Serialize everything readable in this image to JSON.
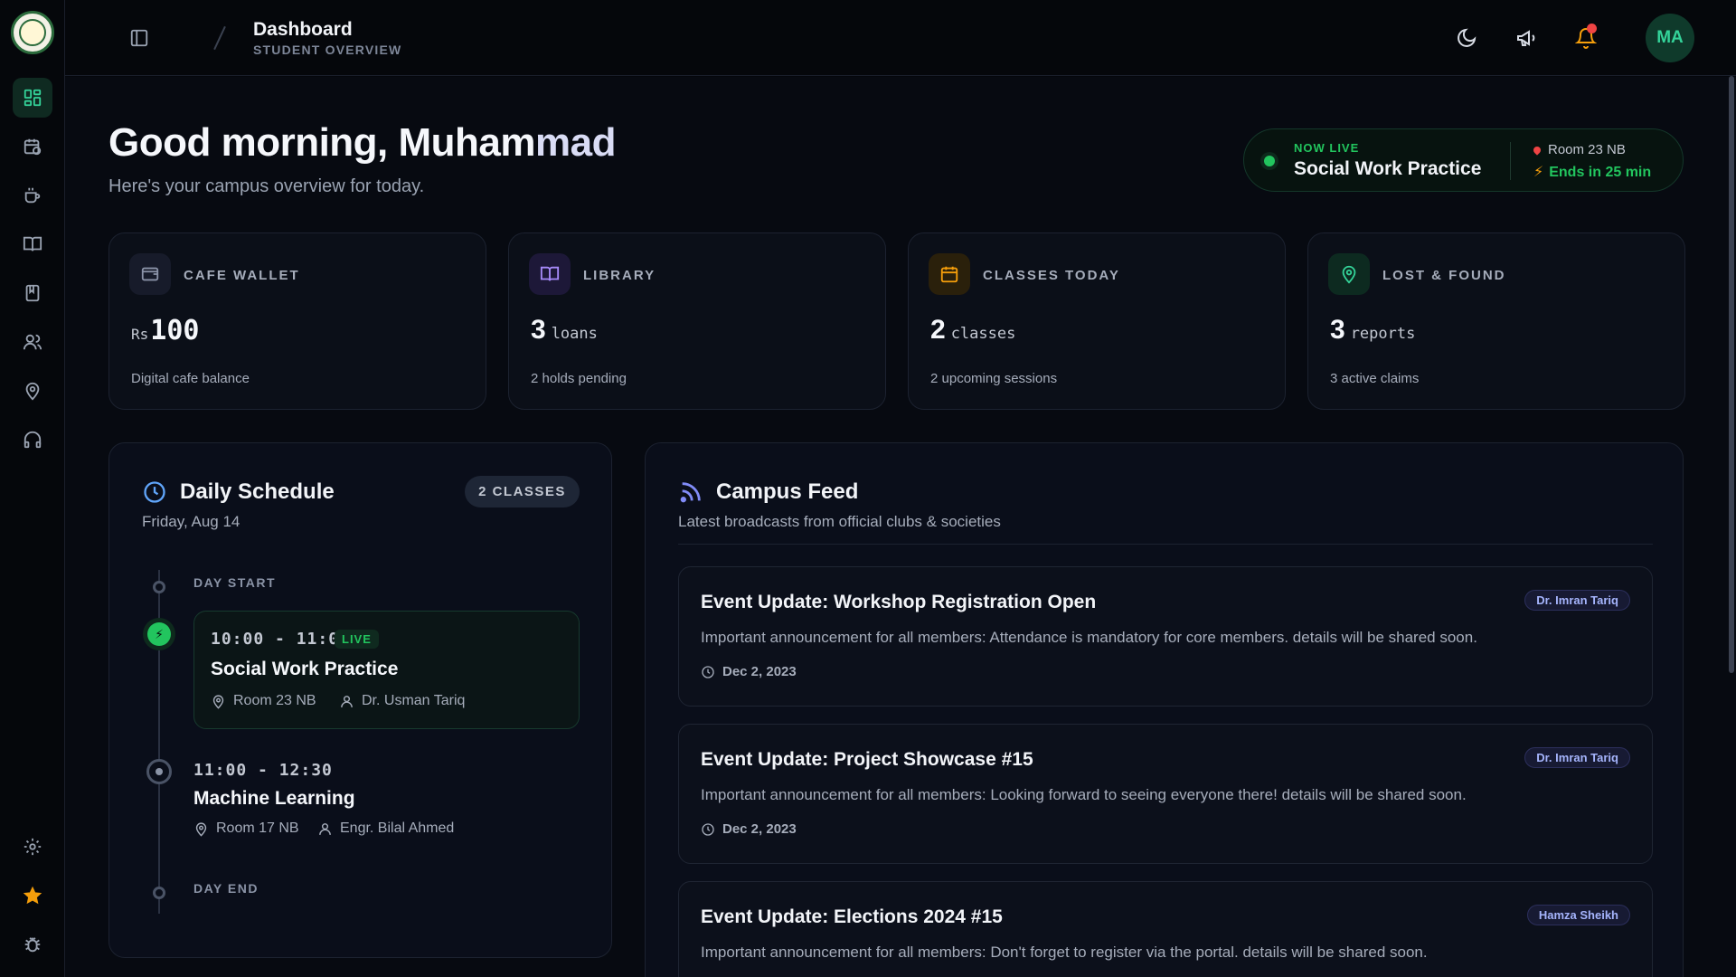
{
  "header": {
    "title": "Dashboard",
    "subtitle": "STUDENT OVERVIEW",
    "avatar_initials": "MA"
  },
  "sidebar": {
    "items": [
      {
        "name": "dashboard",
        "icon": "grid-icon",
        "active": true
      },
      {
        "name": "schedule",
        "icon": "calendar-clock-icon"
      },
      {
        "name": "cafe",
        "icon": "coffee-icon"
      },
      {
        "name": "library",
        "icon": "book-open-icon"
      },
      {
        "name": "notebook",
        "icon": "notebook-icon"
      },
      {
        "name": "users",
        "icon": "users-icon"
      },
      {
        "name": "lost-found",
        "icon": "map-pin-icon"
      },
      {
        "name": "support",
        "icon": "headphones-icon"
      }
    ],
    "bottom": [
      {
        "name": "settings",
        "icon": "gear-icon"
      },
      {
        "name": "favorites",
        "icon": "star-icon"
      },
      {
        "name": "report-bug",
        "icon": "bug-icon"
      }
    ]
  },
  "greeting": {
    "title_main": "Good morning, Muham",
    "title_fade": "mad",
    "subtitle": "Here's your campus overview for today."
  },
  "now_live": {
    "label": "NOW LIVE",
    "title": "Social Work Practice",
    "room": "Room 23 NB",
    "ends": "Ends in 25 min"
  },
  "stats": [
    {
      "label": "CAFE WALLET",
      "prefix": "Rs",
      "value": "100",
      "unit": "",
      "foot": "Digital cafe balance",
      "color": "#8b93a8",
      "icon": "wallet-icon"
    },
    {
      "label": "LIBRARY",
      "prefix": "",
      "value": "3",
      "unit": "loans",
      "foot": "2 holds pending",
      "color": "#a78bfa",
      "icon": "book-open-icon"
    },
    {
      "label": "CLASSES TODAY",
      "prefix": "",
      "value": "2",
      "unit": "classes",
      "foot": "2 upcoming sessions",
      "color": "#f59e0b",
      "icon": "calendar-icon"
    },
    {
      "label": "LOST & FOUND",
      "prefix": "",
      "value": "3",
      "unit": "reports",
      "foot": "3 active claims",
      "color": "#34d399",
      "icon": "map-pin-icon"
    }
  ],
  "schedule": {
    "title": "Daily Schedule",
    "date": "Friday, Aug 14",
    "badge": "2 CLASSES",
    "day_start": "DAY START",
    "day_end": "DAY END",
    "classes": [
      {
        "time": "10:00 - 11:00",
        "live_tag": "LIVE",
        "name": "Social Work Practice",
        "room": "Room 23 NB",
        "instructor": "Dr. Usman Tariq"
      },
      {
        "time": "11:00 - 12:30",
        "name": "Machine Learning",
        "room": "Room 17 NB",
        "instructor": "Engr. Bilal Ahmed"
      }
    ]
  },
  "feed": {
    "title": "Campus Feed",
    "subtitle": "Latest broadcasts from official clubs & societies",
    "posts": [
      {
        "title": "Event Update: Workshop Registration Open",
        "author": "Dr. Imran Tariq",
        "body": "Important announcement for all members: Attendance is mandatory for core members. details will be shared soon.",
        "date": "Dec 2, 2023"
      },
      {
        "title": "Event Update: Project Showcase #15",
        "author": "Dr. Imran Tariq",
        "body": "Important announcement for all members: Looking forward to seeing everyone there! details will be shared soon.",
        "date": "Dec 2, 2023"
      },
      {
        "title": "Event Update: Elections 2024 #15",
        "author": "Hamza Sheikh",
        "body": "Important announcement for all members: Don't forget to register via the portal. details will be shared soon.",
        "date": ""
      }
    ]
  },
  "colors": {
    "accent": "#22c55e",
    "background": "#05070c",
    "card": "#0b0f18",
    "notification": "#ef4444"
  }
}
